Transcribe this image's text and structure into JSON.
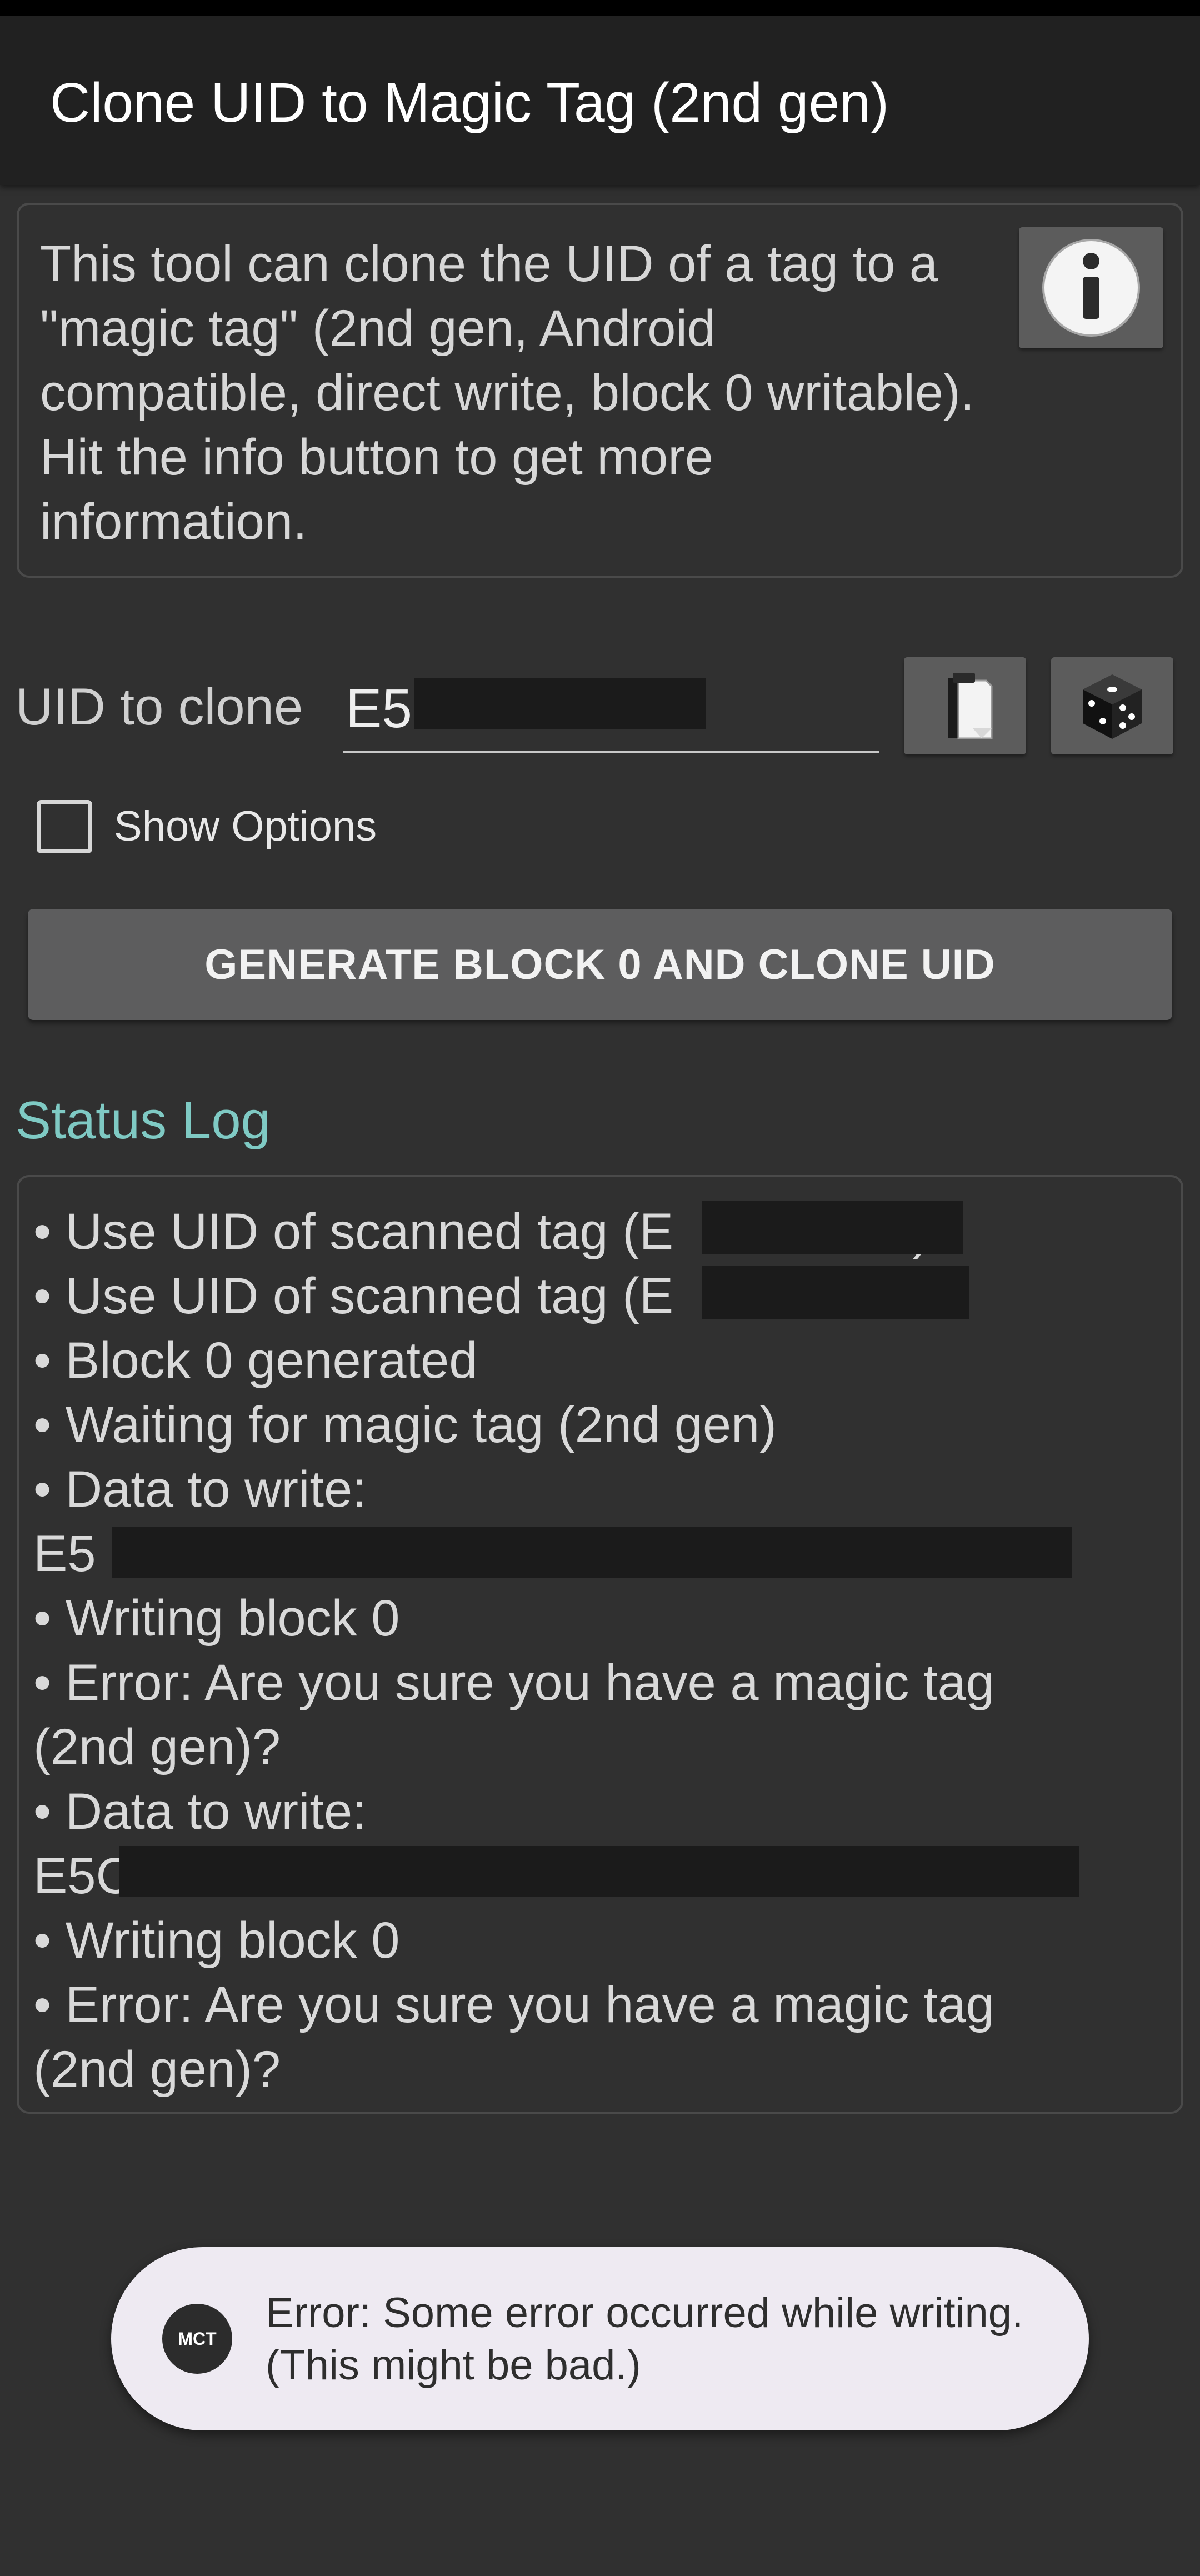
{
  "app_bar": {
    "title": "Clone UID to Magic Tag (2nd gen)"
  },
  "info": {
    "description": "This tool can clone the UID of a tag to a \"magic tag\" (2nd gen, Android compatible, direct write, block 0 writable). Hit the info button to get more information.",
    "button_icon": "info-icon"
  },
  "uid": {
    "label": "UID to clone",
    "value": "E5",
    "paste_icon": "paste-clipboard-icon",
    "random_icon": "dice-icon"
  },
  "options": {
    "checked": false,
    "label": "Show Options"
  },
  "generate_button": {
    "label": "GENERATE BLOCK 0 AND CLONE UID"
  },
  "status": {
    "heading": "Status Log",
    "lines": [
      "• Use UID of scanned tag (E",
      "• Use UID of scanned tag (E",
      "• Block 0 generated",
      "• Waiting for magic tag (2nd gen)",
      "• Data to write:",
      "E5",
      "• Writing block 0",
      "• Error: Are you sure you have a magic tag",
      "(2nd gen)?",
      "• Data to write:",
      "E5C",
      "• Writing block 0",
      "• Error: Are you sure you have a magic tag",
      "(2nd gen)?"
    ],
    "line1_suffix": ")"
  },
  "toast": {
    "logo": "MCT",
    "line1": "Error: Some error occurred while writing.",
    "line2": "(This might be bad.)"
  },
  "colors": {
    "background": "#303030",
    "app_bar": "#212121",
    "accent_teal": "#7fcac4",
    "button": "#5d5d5e",
    "toast_bg": "#eeeaf2"
  }
}
